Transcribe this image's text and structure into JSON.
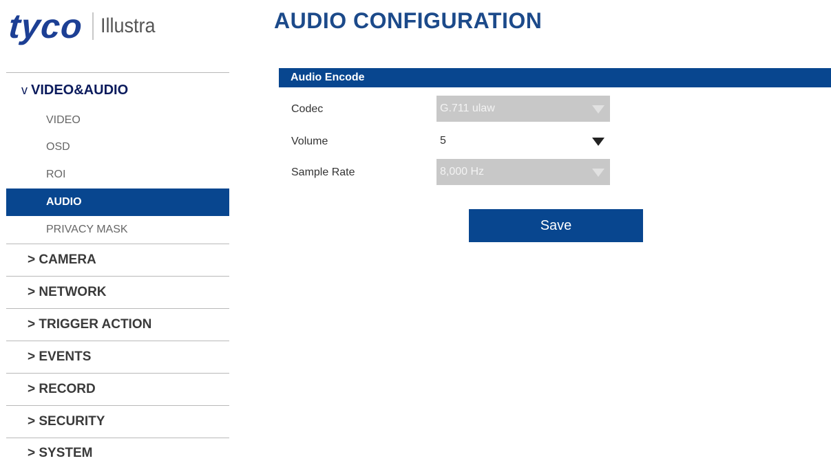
{
  "logo": {
    "brand": "tyco",
    "product": "Illustra"
  },
  "page_title": "AUDIO CONFIGURATION",
  "sidebar": {
    "open_section": {
      "chevron": "v",
      "label": "VIDEO&AUDIO"
    },
    "sub_items": [
      {
        "label": "VIDEO",
        "active": false
      },
      {
        "label": "OSD",
        "active": false
      },
      {
        "label": "ROI",
        "active": false
      },
      {
        "label": "AUDIO",
        "active": true
      },
      {
        "label": "PRIVACY MASK",
        "active": false
      }
    ],
    "sections": [
      {
        "label": "> CAMERA"
      },
      {
        "label": "> NETWORK"
      },
      {
        "label": "> TRIGGER ACTION"
      },
      {
        "label": "> EVENTS"
      },
      {
        "label": "> RECORD"
      },
      {
        "label": "> SECURITY"
      },
      {
        "label": "> SYSTEM"
      }
    ]
  },
  "panel": {
    "header": "Audio Encode",
    "fields": [
      {
        "label": "Codec",
        "value": "G.711 ulaw",
        "disabled": true
      },
      {
        "label": "Volume",
        "value": "5",
        "disabled": false
      },
      {
        "label": "Sample Rate",
        "value": "8,000 Hz",
        "disabled": true
      }
    ],
    "save_label": "Save"
  },
  "colors": {
    "brand_blue": "#1c3f94",
    "accent_blue": "#08468f",
    "disabled_gray": "#c8c8c8",
    "nav_dark": "#0a1a5c"
  },
  "icons": {
    "dropdown": "triangle-down-icon"
  }
}
